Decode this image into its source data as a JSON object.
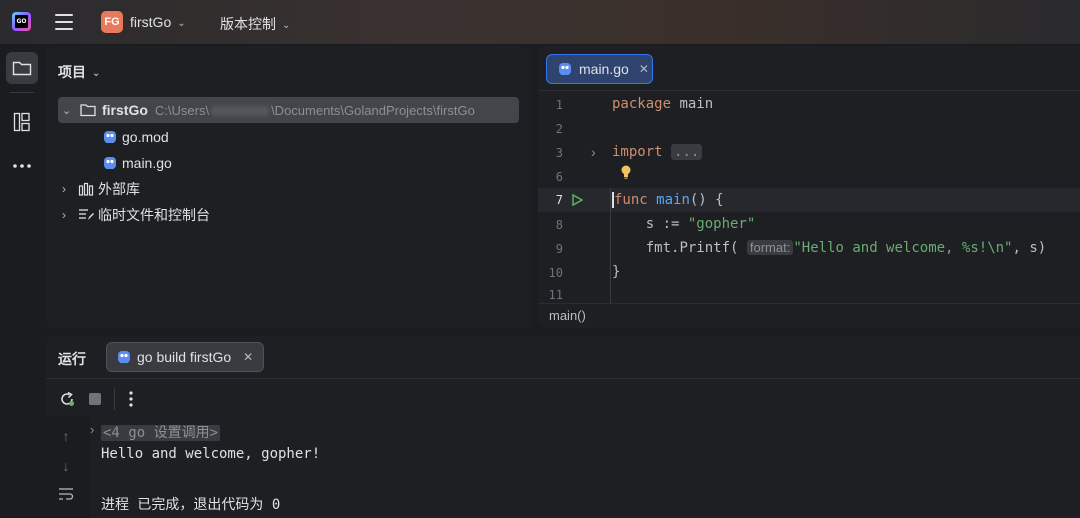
{
  "titlebar": {
    "app_logo_text": "GO",
    "project_badge": "FG",
    "project_name": "firstGo",
    "vcs_label": "版本控制"
  },
  "project_panel": {
    "title": "项目",
    "tree": [
      {
        "label": "firstGo",
        "path_prefix": "C:\\Users\\",
        "path_suffix": "\\Documents\\GolandProjects\\firstGo",
        "icon": "folder-icon"
      },
      {
        "label": "go.mod",
        "icon": "gopher-file-icon"
      },
      {
        "label": "main.go",
        "icon": "gopher-file-icon"
      },
      {
        "label": "外部库",
        "icon": "library-icon"
      },
      {
        "label": "临时文件和控制台",
        "icon": "scratch-icon"
      }
    ]
  },
  "editor": {
    "tab_label": "main.go",
    "line_numbers": [
      "1",
      "2",
      "3",
      "6",
      "7",
      "8",
      "9",
      "10",
      "11"
    ],
    "code": {
      "l1_kw": "package",
      "l1_name": " main",
      "l3_kw": "import",
      "l3_fold": "...",
      "l7_kw": "func",
      "l7_fn": "main",
      "l7_rest": "() {",
      "l8_a": "    s := ",
      "l8_str": "\"gopher\"",
      "l9_a": "    fmt.",
      "l9_fn": "Printf",
      "l9_paren": "( ",
      "l9_hint": "format:",
      "l9_str": "\"Hello and welcome, %s!\\n\"",
      "l9_rest": ", s)",
      "l10": "}"
    },
    "breadcrumb": "main()"
  },
  "run_panel": {
    "title": "运行",
    "tab_label": "go build firstGo",
    "console": {
      "fold_line": "<4 go 设置调用>",
      "output_line": "Hello and welcome, gopher!",
      "exit_line": "进程 已完成，退出代码为 0"
    }
  },
  "colors": {
    "accent": "#3574f0",
    "keyword": "#cf8e6d",
    "function": "#56a8f5",
    "string": "#6aab73"
  }
}
